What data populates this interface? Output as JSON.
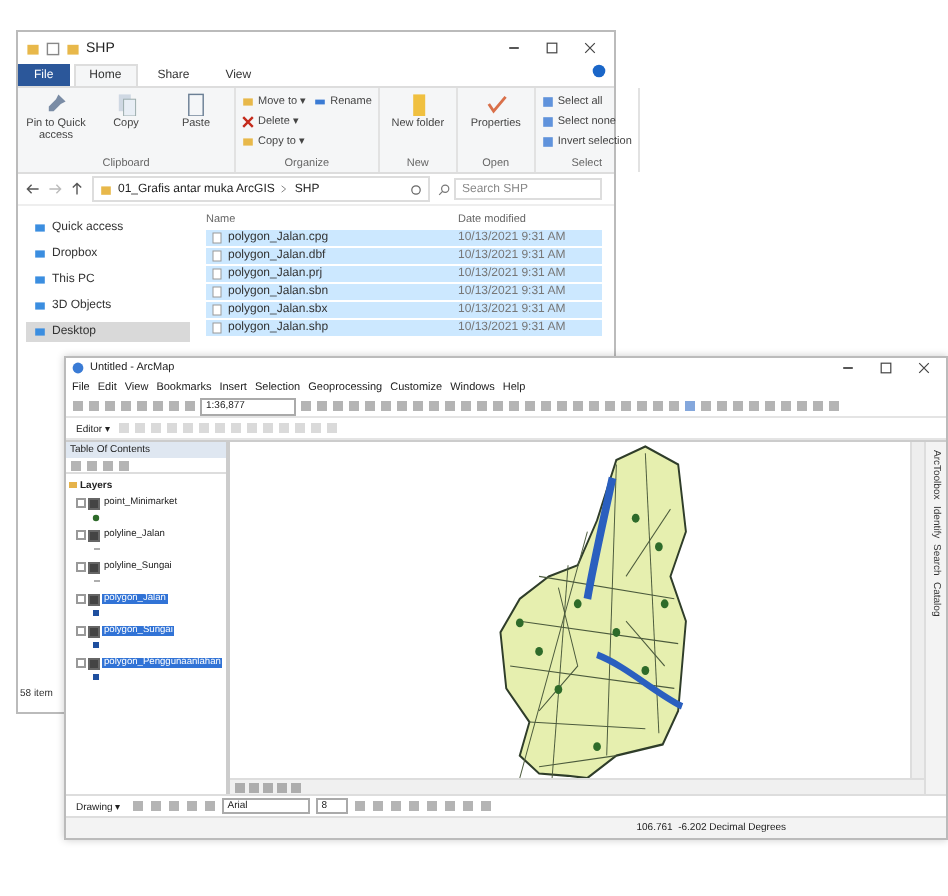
{
  "explorer": {
    "title": "SHP",
    "tabs": [
      {
        "label": "File",
        "selected": false
      },
      {
        "label": "Home",
        "selected": true
      },
      {
        "label": "Share",
        "selected": false
      },
      {
        "label": "View",
        "selected": false
      }
    ],
    "ribbon_groups": [
      {
        "label": "Clipboard",
        "items": [
          {
            "kind": "large",
            "label": "Pin to Quick access"
          },
          {
            "kind": "large",
            "label": "Copy"
          },
          {
            "kind": "large",
            "label": "Paste"
          }
        ]
      },
      {
        "label": "Organize",
        "items": [
          {
            "kind": "small",
            "label": "Move to ▾"
          },
          {
            "kind": "small",
            "label": "Delete ▾"
          },
          {
            "kind": "small",
            "label": "Copy to ▾"
          },
          {
            "kind": "small",
            "label": "Rename"
          }
        ]
      },
      {
        "label": "New",
        "items": [
          {
            "kind": "large",
            "label": "New folder"
          }
        ]
      },
      {
        "label": "Open",
        "items": [
          {
            "kind": "large",
            "label": "Properties"
          }
        ]
      },
      {
        "label": "Select",
        "items": [
          {
            "kind": "small",
            "label": "Select all"
          },
          {
            "kind": "small",
            "label": "Select none"
          },
          {
            "kind": "small",
            "label": "Invert selection"
          }
        ]
      }
    ],
    "path": [
      "01_Grafis antar muka ArcGIS",
      "SHP"
    ],
    "search": {
      "placeholder": "Search SHP"
    },
    "nav": [
      {
        "label": "Quick access",
        "selected": false
      },
      {
        "label": "Dropbox",
        "selected": false
      },
      {
        "label": "This PC",
        "selected": false
      },
      {
        "label": "3D Objects",
        "selected": false
      },
      {
        "label": "Desktop",
        "selected": true
      }
    ],
    "columns": [
      "Name",
      "Date modified"
    ],
    "files": [
      {
        "name": "polygon_Jalan.cpg",
        "date": "10/13/2021 9:31 AM",
        "selected": true
      },
      {
        "name": "polygon_Jalan.dbf",
        "date": "10/13/2021 9:31 AM",
        "selected": true
      },
      {
        "name": "polygon_Jalan.prj",
        "date": "10/13/2021 9:31 AM",
        "selected": true
      },
      {
        "name": "polygon_Jalan.sbn",
        "date": "10/13/2021 9:31 AM",
        "selected": true
      },
      {
        "name": "polygon_Jalan.sbx",
        "date": "10/13/2021 9:31 AM",
        "selected": true
      },
      {
        "name": "polygon_Jalan.shp",
        "date": "10/13/2021 9:31 AM",
        "selected": true
      }
    ],
    "status": "58 item"
  },
  "arcmap": {
    "title": "Untitled - ArcMap",
    "menu": [
      "File",
      "Edit",
      "View",
      "Bookmarks",
      "Insert",
      "Selection",
      "Geoprocessing",
      "Customize",
      "Windows",
      "Help"
    ],
    "scale": "1:36,877",
    "editor": "Editor ▾",
    "toc": {
      "title": "Table Of Contents",
      "root": "Layers",
      "layers": [
        {
          "name": "point_Minimarket",
          "kind": "point",
          "checked": true,
          "selected": false
        },
        {
          "name": "polyline_Jalan",
          "kind": "line",
          "checked": true,
          "selected": false
        },
        {
          "name": "polyline_Sungai",
          "kind": "line",
          "checked": true,
          "selected": false
        },
        {
          "name": "polygon_Jalan",
          "kind": "polygon",
          "checked": true,
          "selected": true
        },
        {
          "name": "polygon_Sungai",
          "kind": "polygon",
          "checked": true,
          "selected": true
        },
        {
          "name": "polygon_Penggunaanlahan",
          "kind": "polygon",
          "checked": true,
          "selected": true
        }
      ]
    },
    "side_tabs": [
      "ArcToolbox",
      "Identify",
      "Search",
      "Catalog"
    ],
    "drawing": {
      "label": "Drawing ▾",
      "font": "Arial",
      "size": "8"
    },
    "coordinates": "106.761  -6.202 Decimal Degrees"
  }
}
